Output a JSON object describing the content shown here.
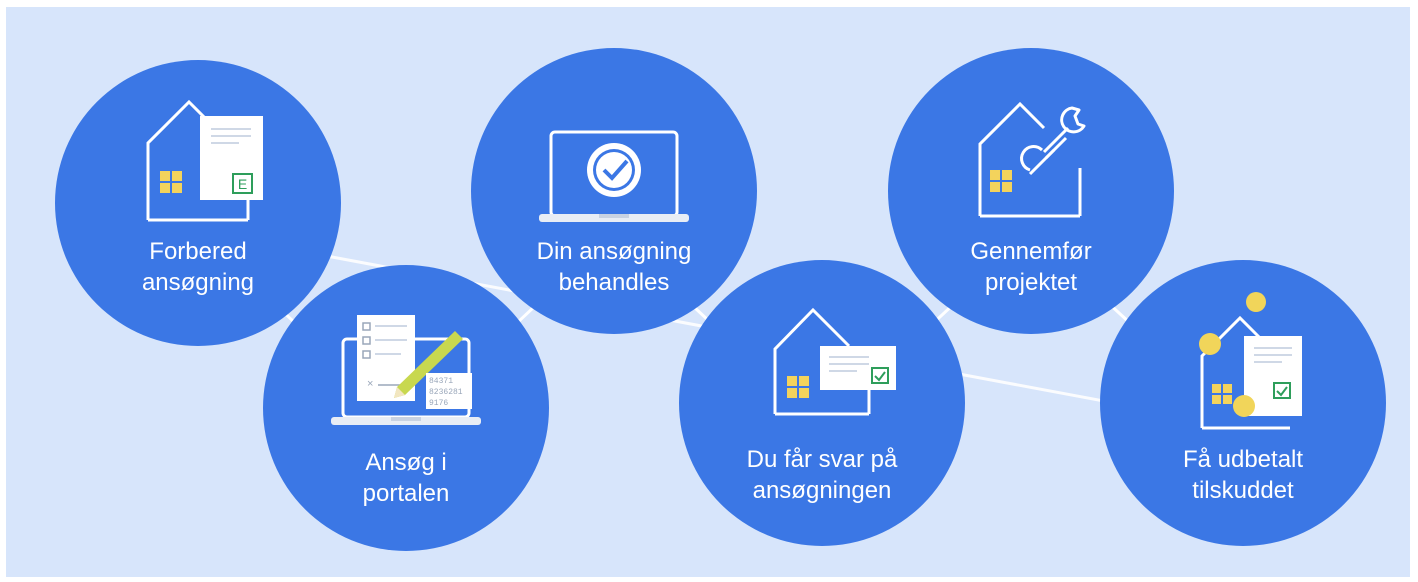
{
  "colors": {
    "background": "#d7e5fb",
    "circle": "#3b77e5",
    "outline": "#ffffff",
    "window": "#f3d35c",
    "paper": "#ffffff",
    "check": "#2e9e5b",
    "pencil": "#c8d84f",
    "coin": "#f1d55a"
  },
  "steps": [
    {
      "icon": "house-document-energy-icon",
      "line1": "Forbered",
      "line2": "ansøgning",
      "badge": "E"
    },
    {
      "icon": "laptop-form-pencil-icon",
      "line1": "Ansøg i",
      "line2": "portalen",
      "numbers": [
        "84371",
        "8236281",
        "9176"
      ]
    },
    {
      "icon": "laptop-clock-check-icon",
      "line1": "Din ansøgning",
      "line2": "behandles"
    },
    {
      "icon": "house-letter-check-icon",
      "line1": "Du får svar på",
      "line2": "ansøgningen"
    },
    {
      "icon": "house-wrench-icon",
      "line1": "Gennemfør",
      "line2": "projektet"
    },
    {
      "icon": "house-coins-document-icon",
      "line1": "Få udbetalt",
      "line2": "tilskuddet"
    }
  ]
}
